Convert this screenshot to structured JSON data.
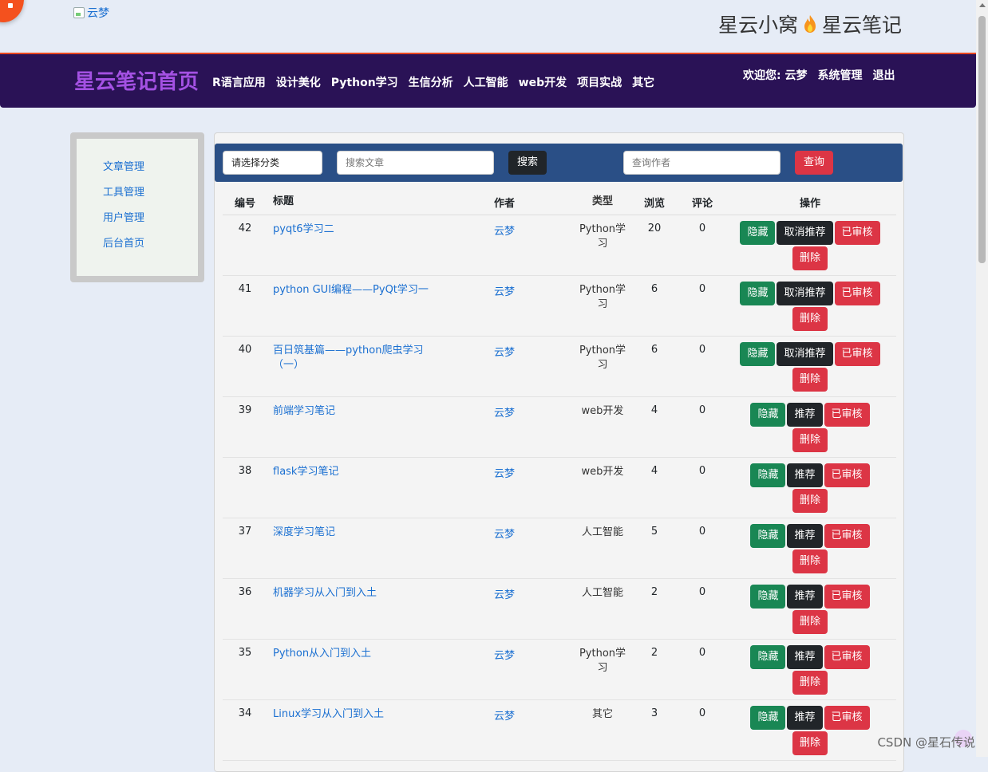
{
  "header": {
    "logo_alt": "云梦",
    "site_name_left": "星云小窝",
    "site_name_right": "星云笔记"
  },
  "navbar": {
    "brand": "星云笔记首页",
    "menu": [
      "R语言应用",
      "设计美化",
      "Python学习",
      "生信分析",
      "人工智能",
      "web开发",
      "项目实战",
      "其它"
    ],
    "user": [
      "欢迎您: 云梦",
      "系统管理",
      "退出"
    ]
  },
  "sidebar": {
    "items": [
      "文章管理",
      "工具管理",
      "用户管理",
      "后台首页"
    ]
  },
  "search": {
    "category_value": "请选择分类",
    "article_placeholder": "搜索文章",
    "search_label": "搜索",
    "author_placeholder": "查询作者",
    "query_label": "查询"
  },
  "table": {
    "headers": {
      "id": "编号",
      "title": "标题",
      "author": "作者",
      "type": "类型",
      "views": "浏览",
      "comments": "评论",
      "ops": "操作"
    },
    "rows": [
      {
        "id": "42",
        "title": "pyqt6学习二",
        "author": "云梦",
        "type": "Python学习",
        "views": "20",
        "comments": "0",
        "hide": "隐藏",
        "recommend": "取消推荐",
        "reviewed": "已审核",
        "delete": "删除"
      },
      {
        "id": "41",
        "title": "python GUI编程——PyQt学习一",
        "author": "云梦",
        "type": "Python学习",
        "views": "6",
        "comments": "0",
        "hide": "隐藏",
        "recommend": "取消推荐",
        "reviewed": "已审核",
        "delete": "删除"
      },
      {
        "id": "40",
        "title": "百日筑基篇——python爬虫学习（一）",
        "author": "云梦",
        "type": "Python学习",
        "views": "6",
        "comments": "0",
        "hide": "隐藏",
        "recommend": "取消推荐",
        "reviewed": "已审核",
        "delete": "删除"
      },
      {
        "id": "39",
        "title": "前端学习笔记",
        "author": "云梦",
        "type": "web开发",
        "views": "4",
        "comments": "0",
        "hide": "隐藏",
        "recommend": "推荐",
        "reviewed": "已审核",
        "delete": "删除"
      },
      {
        "id": "38",
        "title": "flask学习笔记",
        "author": "云梦",
        "type": "web开发",
        "views": "4",
        "comments": "0",
        "hide": "隐藏",
        "recommend": "推荐",
        "reviewed": "已审核",
        "delete": "删除"
      },
      {
        "id": "37",
        "title": "深度学习笔记",
        "author": "云梦",
        "type": "人工智能",
        "views": "5",
        "comments": "0",
        "hide": "隐藏",
        "recommend": "推荐",
        "reviewed": "已审核",
        "delete": "删除"
      },
      {
        "id": "36",
        "title": "机器学习从入门到入土",
        "author": "云梦",
        "type": "人工智能",
        "views": "2",
        "comments": "0",
        "hide": "隐藏",
        "recommend": "推荐",
        "reviewed": "已审核",
        "delete": "删除"
      },
      {
        "id": "35",
        "title": "Python从入门到入土",
        "author": "云梦",
        "type": "Python学习",
        "views": "2",
        "comments": "0",
        "hide": "隐藏",
        "recommend": "推荐",
        "reviewed": "已审核",
        "delete": "删除"
      },
      {
        "id": "34",
        "title": "Linux学习从入门到入土",
        "author": "云梦",
        "type": "其它",
        "views": "3",
        "comments": "0",
        "hide": "隐藏",
        "recommend": "推荐",
        "reviewed": "已审核",
        "delete": "删除"
      }
    ]
  },
  "watermark": "CSDN @星石传说",
  "colors": {
    "navbar": "#2a1256",
    "brand": "#a451e3",
    "searchbar": "#2a4f86",
    "green": "#198754",
    "dark": "#212529",
    "red": "#dc3545"
  }
}
